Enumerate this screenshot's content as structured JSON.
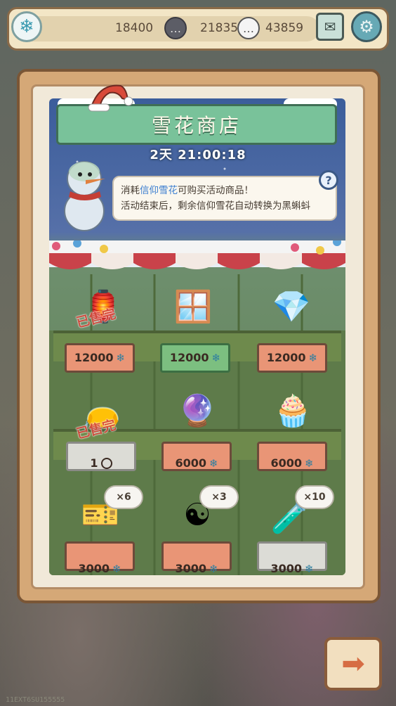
{
  "currencies": {
    "snowflake": "18400",
    "bubble_dark": "21835",
    "bubble_light": "43859"
  },
  "shop": {
    "title": "雪花商店",
    "timer": "2天 21:00:18",
    "info_line1_prefix": "消耗",
    "info_line1_highlight": "信仰雪花",
    "info_line1_suffix": "可购买活动商品！",
    "info_line2": "活动结束后，剩余信仰雪花自动转换为黑蝌蚪",
    "help": "?"
  },
  "items": [
    {
      "price": "12000",
      "currency": "snowflake",
      "sold_out": "已售完",
      "icon": "lantern-icon"
    },
    {
      "price": "12000",
      "currency": "snowflake",
      "icon": "window-icon"
    },
    {
      "price": "12000",
      "currency": "snowflake",
      "icon": "amulet-icon"
    },
    {
      "price": "1",
      "currency": "bubble",
      "sold_out": "已售完",
      "icon": "pouch-icon"
    },
    {
      "price": "6000",
      "currency": "snowflake",
      "icon": "orb-icon"
    },
    {
      "price": "6000",
      "currency": "snowflake",
      "icon": "cupcake-icon"
    },
    {
      "price": "3000",
      "currency": "snowflake",
      "quantity": "×6",
      "icon": "ticket-icon"
    },
    {
      "price": "3000",
      "currency": "snowflake",
      "quantity": "×3",
      "icon": "yinyang-coin-icon"
    },
    {
      "price": "3000",
      "currency": "snowflake",
      "quantity": "×10",
      "icon": "potion-icon"
    }
  ],
  "footer_id": "11EXT6SU155555",
  "colors": {
    "accent_green": "#79c29a",
    "sold_red": "#d64a3e",
    "frame_wood": "#d5a877"
  }
}
